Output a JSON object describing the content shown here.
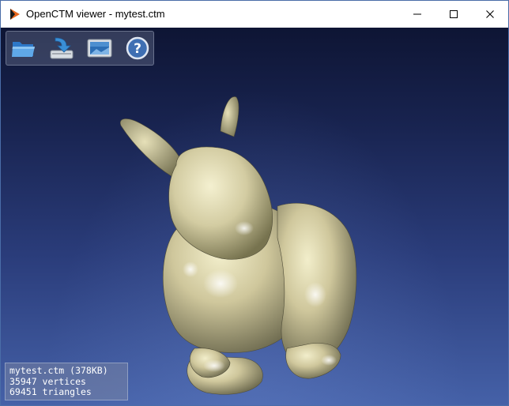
{
  "window": {
    "title": "OpenCTM viewer - mytest.ctm",
    "controls": [
      "minimize",
      "maximize",
      "close"
    ]
  },
  "toolbar": {
    "buttons": [
      {
        "name": "open",
        "icon": "folder-open-icon"
      },
      {
        "name": "save",
        "icon": "save-download-icon"
      },
      {
        "name": "screenshot",
        "icon": "picture-icon"
      },
      {
        "name": "help",
        "icon": "help-icon",
        "glyph": "?"
      }
    ]
  },
  "viewport": {
    "model_name": "bunny mesh",
    "background_top": "#0e1534",
    "background_bottom": "#4561a8",
    "model_color": "#d8d2a8"
  },
  "info": {
    "line1": "mytest.ctm (378KB)",
    "line2": "35947 vertices",
    "line3": "69451 triangles"
  }
}
